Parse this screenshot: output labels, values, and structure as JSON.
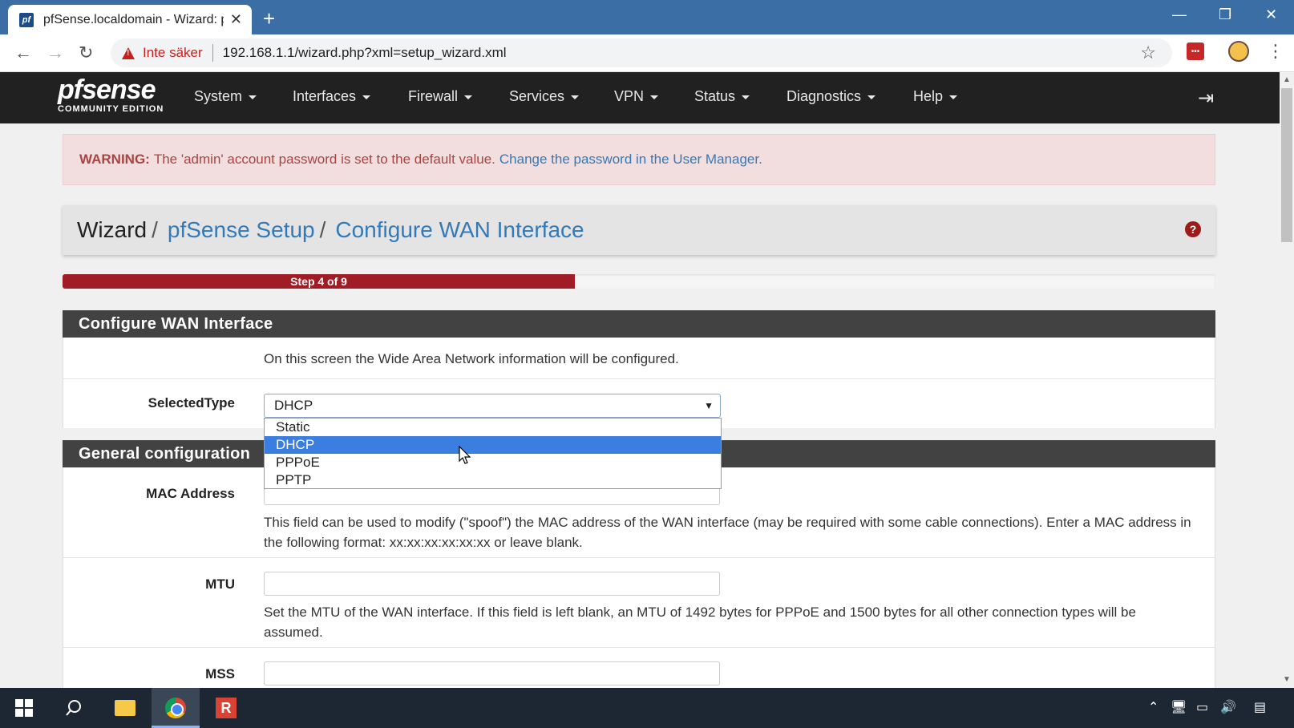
{
  "browser": {
    "tab_title": "pfSense.localdomain - Wizard: pf",
    "tab_favicon": "pf",
    "new_tab": "+",
    "security_label": "Inte säker",
    "url": "192.168.1.1/wizard.php?xml=setup_wizard.xml",
    "extension_badge": "•••"
  },
  "logo": {
    "main": "pfsense",
    "sub": "COMMUNITY EDITION"
  },
  "nav": {
    "items": [
      "System",
      "Interfaces",
      "Firewall",
      "Services",
      "VPN",
      "Status",
      "Diagnostics",
      "Help"
    ]
  },
  "warning": {
    "prefix": "WARNING:",
    "message": "The 'admin' account password is set to the default value.",
    "link": "Change the password in the User Manager."
  },
  "breadcrumb": {
    "items": [
      "Wizard",
      "pfSense Setup",
      "Configure WAN Interface"
    ],
    "separator": "/"
  },
  "progress": {
    "label": "Step 4 of 9",
    "current": 4,
    "total": 9
  },
  "wan_panel": {
    "title": "Configure WAN Interface",
    "intro": "On this screen the Wide Area Network information will be configured.",
    "selected_type_label": "SelectedType",
    "selected_type_value": "DHCP",
    "options": [
      "Static",
      "DHCP",
      "PPPoE",
      "PPTP"
    ],
    "highlighted_option": "DHCP"
  },
  "general_panel": {
    "title": "General configuration",
    "mac_label": "MAC Address",
    "mac_value": "",
    "mac_help": "This field can be used to modify (\"spoof\") the MAC address of the WAN interface (may be required with some cable connections). Enter a MAC address in the following format: xx:xx:xx:xx:xx:xx or leave blank.",
    "mtu_label": "MTU",
    "mtu_value": "",
    "mtu_help": "Set the MTU of the WAN interface. If this field is left blank, an MTU of 1492 bytes for PPPoE and 1500 bytes for all other connection types will be assumed.",
    "mss_label": "MSS",
    "mss_value": ""
  },
  "colors": {
    "accent_link": "#337ab7",
    "progress_fill": "#a01d26",
    "panel_header": "#424242",
    "nav_bg": "#212121",
    "warning_bg": "#f2dede",
    "selected_option": "#3a7ee0"
  }
}
